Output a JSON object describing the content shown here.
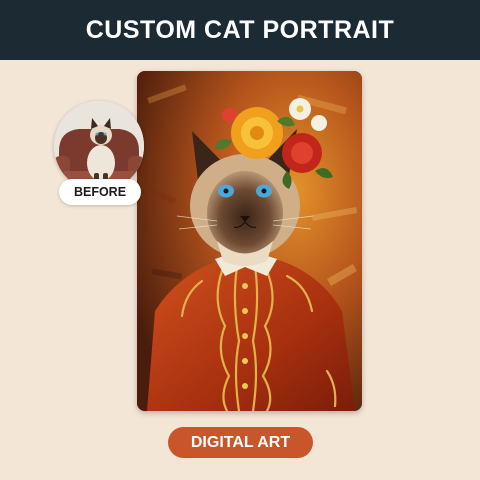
{
  "header": {
    "title": "CUSTOM CAT PORTRAIT"
  },
  "before": {
    "badge_label": "BEFORE"
  },
  "cta": {
    "label": "DIGITAL ART"
  },
  "colors": {
    "header_bg": "#1c2b33",
    "page_bg": "#f4e6d7",
    "cta_bg": "#c9562a",
    "text_light": "#ffffff"
  },
  "portrait": {
    "subject": "siamese cat in red embroidered jacket with flower crown"
  }
}
